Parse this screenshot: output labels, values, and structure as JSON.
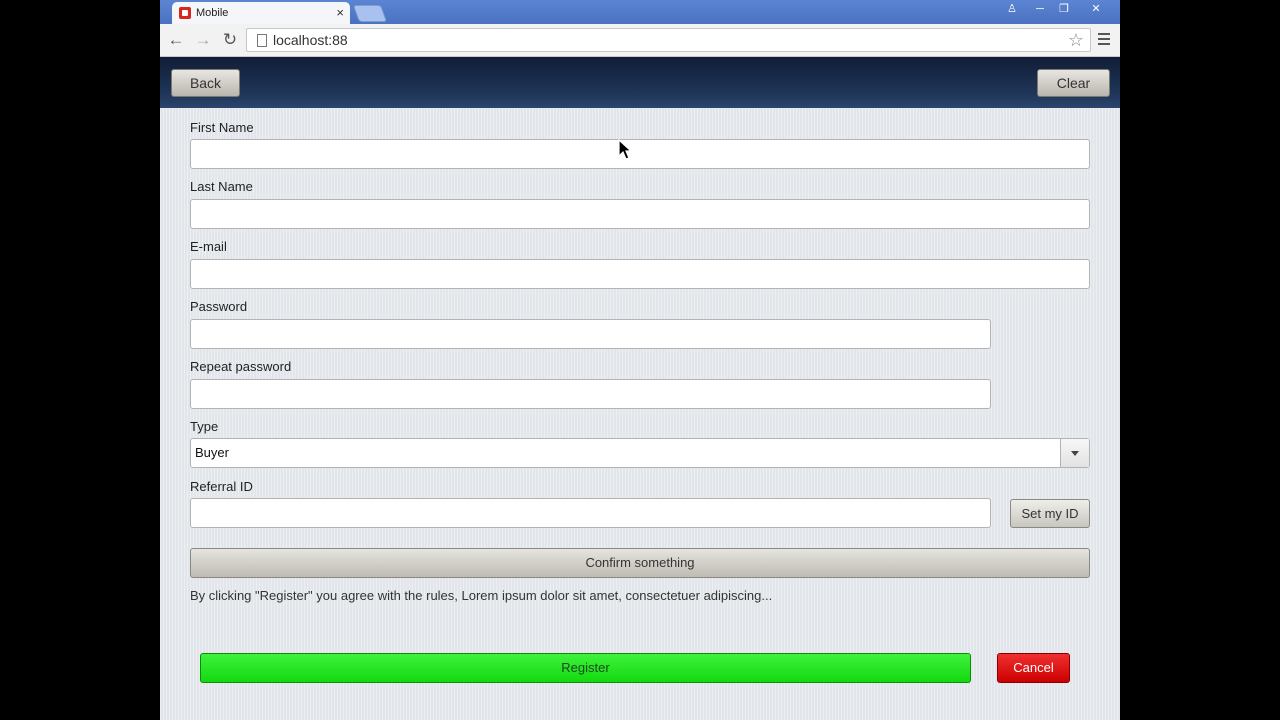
{
  "browser": {
    "tab_title": "Mobile",
    "url": "localhost:88",
    "icons": [
      "back-icon",
      "forward-icon",
      "reload-icon",
      "page-icon",
      "star-icon",
      "menu-icon",
      "close-icon"
    ]
  },
  "header": {
    "back_label": "Back",
    "clear_label": "Clear"
  },
  "form": {
    "first_name_label": "First Name",
    "first_name_value": "",
    "last_name_label": "Last Name",
    "last_name_value": "",
    "email_label": "E-mail",
    "email_value": "",
    "password_label": "Password",
    "password_value": "",
    "repeat_password_label": "Repeat password",
    "repeat_password_value": "",
    "type_label": "Type",
    "type_value": "Buyer",
    "referral_label": "Referral ID",
    "referral_value": "",
    "set_id_label": "Set my ID",
    "confirm_label": "Confirm something",
    "agree_text": "By clicking \"Register\" you agree with the rules, Lorem ipsum dolor sit amet, consectetuer adipiscing...",
    "register_label": "Register",
    "cancel_label": "Cancel"
  },
  "colors": {
    "header_bg": "#1f3558",
    "register": "#22e41f",
    "cancel": "#dd0000",
    "tab_strip": "#5b84d2"
  }
}
